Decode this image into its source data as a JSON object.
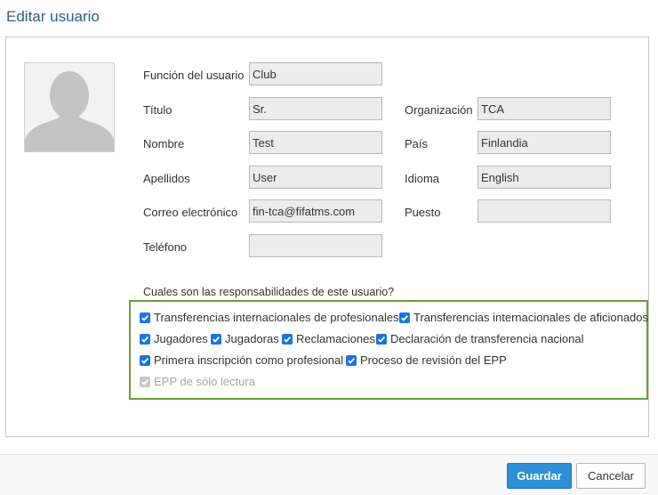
{
  "dialog": {
    "title": "Editar usuario"
  },
  "form": {
    "role": {
      "label": "Función del usuario",
      "value": "Club"
    },
    "title": {
      "label": "Título",
      "value": "Sr."
    },
    "first_name": {
      "label": "Nombre",
      "value": "Test"
    },
    "last_name": {
      "label": "Apellidos",
      "value": "User"
    },
    "email": {
      "label": "Correo electrónico",
      "value": "fin-tca@fifatms.com"
    },
    "phone": {
      "label": "Teléfono",
      "value": ""
    },
    "organization": {
      "label": "Organización",
      "value": "TCA"
    },
    "country": {
      "label": "País",
      "value": "Finlandia"
    },
    "language": {
      "label": "Idioma",
      "value": "English"
    },
    "position": {
      "label": "Puesto",
      "value": ""
    }
  },
  "responsibilities": {
    "question": "Cuales son las responsabilidades de este usuario?",
    "items": [
      {
        "label": "Transferencias internacionales de profesionales",
        "checked": true,
        "disabled": false
      },
      {
        "label": "Transferencias internacionales de aficionados",
        "checked": true,
        "disabled": false
      },
      {
        "label": "Jugadores",
        "checked": true,
        "disabled": false
      },
      {
        "label": "Jugadoras",
        "checked": true,
        "disabled": false
      },
      {
        "label": "Reclamaciones",
        "checked": true,
        "disabled": false
      },
      {
        "label": "Declaración de transferencia nacional",
        "checked": true,
        "disabled": false
      },
      {
        "label": "Primera inscripción como profesional",
        "checked": true,
        "disabled": false
      },
      {
        "label": "Proceso de revisión del EPP",
        "checked": true,
        "disabled": false
      },
      {
        "label": "EPP de sólo lectura",
        "checked": true,
        "disabled": true
      }
    ]
  },
  "buttons": {
    "save": "Guardar",
    "cancel": "Cancelar"
  },
  "colors": {
    "accent": "#2d8fd5",
    "checkbox": "#1a73e8",
    "highlight_border": "#67a03a",
    "title": "#2a5d8f"
  }
}
